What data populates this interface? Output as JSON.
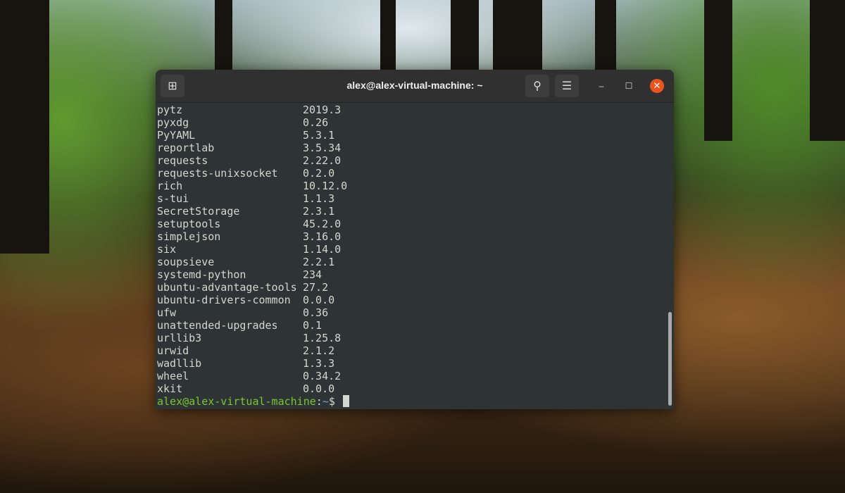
{
  "window": {
    "title": "alex@alex-virtual-machine: ~"
  },
  "packages": [
    {
      "name": "pytz",
      "version": "2019.3"
    },
    {
      "name": "pyxdg",
      "version": "0.26"
    },
    {
      "name": "PyYAML",
      "version": "5.3.1"
    },
    {
      "name": "reportlab",
      "version": "3.5.34"
    },
    {
      "name": "requests",
      "version": "2.22.0"
    },
    {
      "name": "requests-unixsocket",
      "version": "0.2.0"
    },
    {
      "name": "rich",
      "version": "10.12.0"
    },
    {
      "name": "s-tui",
      "version": "1.1.3"
    },
    {
      "name": "SecretStorage",
      "version": "2.3.1"
    },
    {
      "name": "setuptools",
      "version": "45.2.0"
    },
    {
      "name": "simplejson",
      "version": "3.16.0"
    },
    {
      "name": "six",
      "version": "1.14.0"
    },
    {
      "name": "soupsieve",
      "version": "2.2.1"
    },
    {
      "name": "systemd-python",
      "version": "234"
    },
    {
      "name": "ubuntu-advantage-tools",
      "version": "27.2"
    },
    {
      "name": "ubuntu-drivers-common",
      "version": "0.0.0"
    },
    {
      "name": "ufw",
      "version": "0.36"
    },
    {
      "name": "unattended-upgrades",
      "version": "0.1"
    },
    {
      "name": "urllib3",
      "version": "1.25.8"
    },
    {
      "name": "urwid",
      "version": "2.1.2"
    },
    {
      "name": "wadllib",
      "version": "1.3.3"
    },
    {
      "name": "wheel",
      "version": "0.34.2"
    },
    {
      "name": "xkit",
      "version": "0.0.0"
    }
  ],
  "prompt": {
    "user_host": "alex@alex-virtual-machine",
    "sep": ":",
    "path": "~",
    "symbol": "$ "
  }
}
